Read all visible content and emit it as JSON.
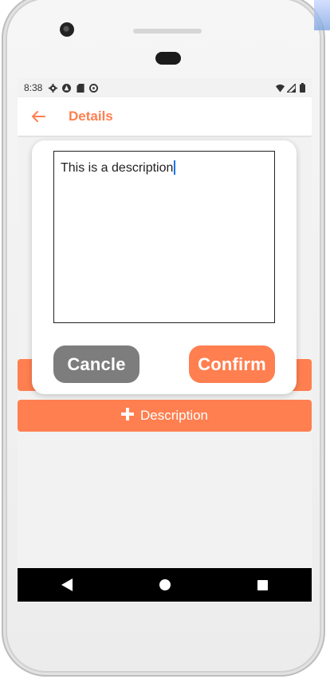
{
  "status_bar": {
    "time": "8:38",
    "left_icons": [
      "gear-icon",
      "android-icon",
      "sd-card-icon",
      "sync-icon"
    ],
    "right_icons": [
      "wifi-icon",
      "signal-icon",
      "battery-icon"
    ]
  },
  "app_bar": {
    "back_icon": "arrow-left-icon",
    "title": "Details"
  },
  "dialog": {
    "text_value": "This is a description",
    "cancel_label": "Cancle",
    "confirm_label": "Confirm"
  },
  "description_button": {
    "icon": "plus-icon",
    "label": "Description"
  },
  "nav_bar": {
    "items": [
      "back-triangle-icon",
      "home-circle-icon",
      "recents-square-icon"
    ]
  },
  "colors": {
    "accent": "#ff7f50",
    "cancel": "#7d7d7d",
    "background": "#f2f2f2",
    "nav_bar": "#000000"
  }
}
